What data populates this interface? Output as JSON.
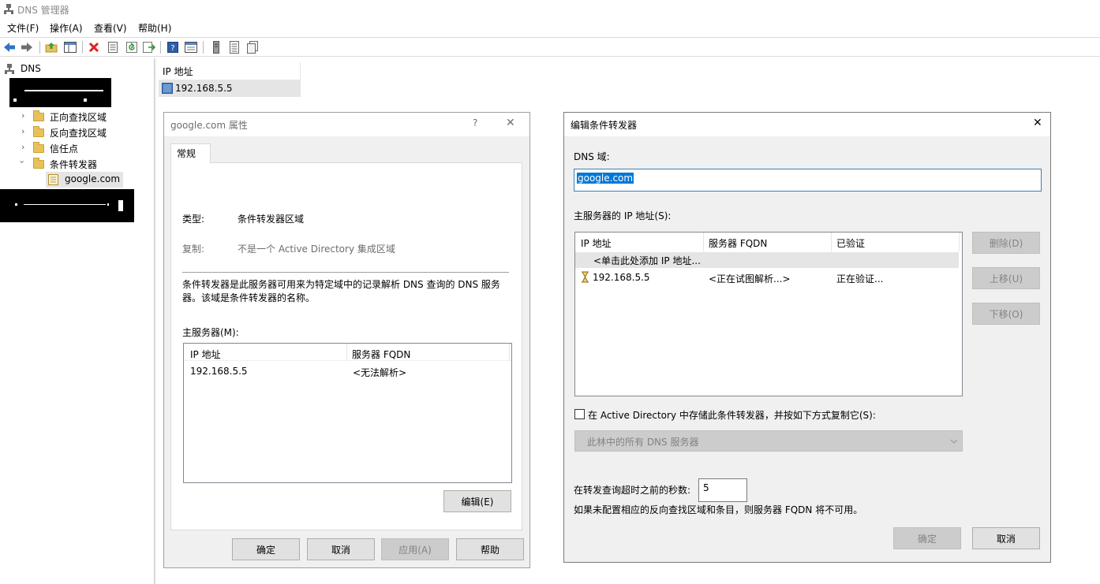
{
  "window": {
    "title": "DNS 管理器"
  },
  "menu": [
    "文件(F)",
    "操作(A)",
    "查看(V)",
    "帮助(H)"
  ],
  "toolbar": {
    "icons": [
      "back-icon",
      "forward-icon",
      "up-folder-icon",
      "show-hide-tree-icon",
      "delete-icon",
      "properties-icon",
      "refresh-icon",
      "export-list-icon",
      "help-icon",
      "console-icon",
      "server-icon",
      "list-icon",
      "copy-icon"
    ]
  },
  "tree": {
    "root": "DNS",
    "items": [
      "正向查找区域",
      "反向查找区域",
      "信任点",
      "条件转发器"
    ],
    "child": "google.com"
  },
  "list": {
    "column": "IP 地址",
    "row": "192.168.5.5"
  },
  "props": {
    "title": "google.com 属性",
    "help": "?",
    "close": "✕",
    "tab": "常规",
    "type_label": "类型:",
    "type_value": "条件转发器区域",
    "repl_label": "复制:",
    "repl_value": "不是一个 Active Directory 集成区域",
    "desc": "条件转发器是此服务器可用来为特定域中的记录解析 DNS 查询的 DNS 服务器。该域是条件转发器的名称。",
    "masters_label": "主服务器(M):",
    "col_ip": "IP 地址",
    "col_fqdn": "服务器 FQDN",
    "row_ip": "192.168.5.5",
    "row_fqdn": "<无法解析>",
    "edit_btn": "编辑(E)",
    "ok": "确定",
    "cancel": "取消",
    "apply": "应用(A)",
    "helpbtn": "帮助"
  },
  "edit": {
    "title": "编辑条件转发器",
    "close": "✕",
    "domain_label": "DNS 域:",
    "domain_value": "google.com",
    "masters_label": "主服务器的 IP 地址(S):",
    "col_ip": "IP 地址",
    "col_fqdn": "服务器 FQDN",
    "col_valid": "已验证",
    "add_row": "<单击此处添加 IP 地址...",
    "row_ip": "192.168.5.5",
    "row_fqdn": "<正在试图解析...>",
    "row_valid": "正在验证...",
    "delete": "删除(D)",
    "up": "上移(U)",
    "down": "下移(O)",
    "ad_store": "在 Active Directory 中存储此条件转发器，并按如下方式复制它(S):",
    "repl_select": "此林中的所有 DNS 服务器",
    "timeout_label": "在转发查询超时之前的秒数:",
    "timeout_value": "5",
    "note": "如果未配置相应的反向查找区域和条目，则服务器 FQDN 将不可用。",
    "ok": "确定",
    "cancel": "取消"
  },
  "colors": {
    "selection": "#0078d7",
    "selected_row": "#e5e5e5",
    "dialog_bg": "#f0f0f0",
    "input_border": "#7a7a7a",
    "accent_blue": "#3c7fb1"
  }
}
